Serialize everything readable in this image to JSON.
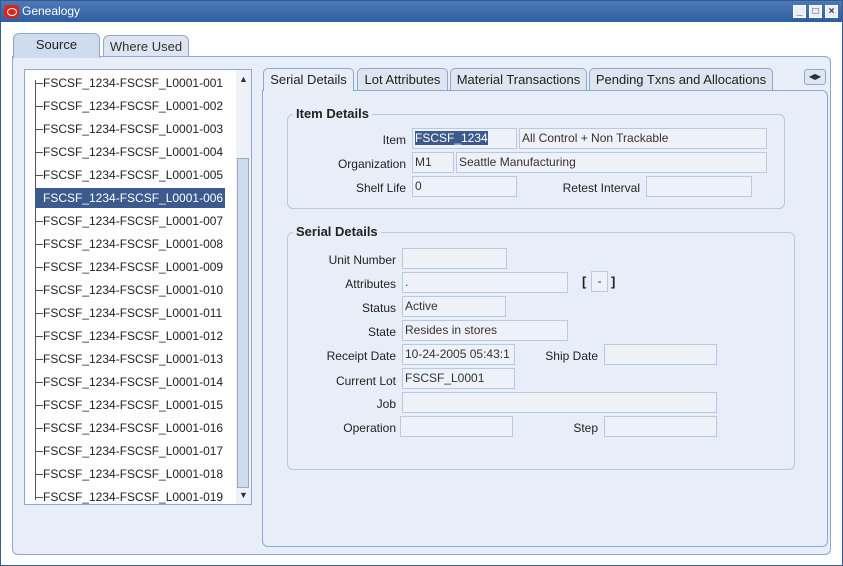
{
  "window": {
    "title": "Genealogy"
  },
  "top_tabs": [
    {
      "label": "Source",
      "active": true
    },
    {
      "label": "Where Used",
      "active": false
    }
  ],
  "tree_items": [
    "FSCSF_1234-FSCSF_L0001-001",
    "FSCSF_1234-FSCSF_L0001-002",
    "FSCSF_1234-FSCSF_L0001-003",
    "FSCSF_1234-FSCSF_L0001-004",
    "FSCSF_1234-FSCSF_L0001-005",
    "FSCSF_1234-FSCSF_L0001-006",
    "FSCSF_1234-FSCSF_L0001-007",
    "FSCSF_1234-FSCSF_L0001-008",
    "FSCSF_1234-FSCSF_L0001-009",
    "FSCSF_1234-FSCSF_L0001-010",
    "FSCSF_1234-FSCSF_L0001-011",
    "FSCSF_1234-FSCSF_L0001-012",
    "FSCSF_1234-FSCSF_L0001-013",
    "FSCSF_1234-FSCSF_L0001-014",
    "FSCSF_1234-FSCSF_L0001-015",
    "FSCSF_1234-FSCSF_L0001-016",
    "FSCSF_1234-FSCSF_L0001-017",
    "FSCSF_1234-FSCSF_L0001-018",
    "FSCSF_1234-FSCSF_L0001-019"
  ],
  "selected_tree_index": 5,
  "sub_tabs": [
    {
      "label": "Serial Details",
      "active": true
    },
    {
      "label": "Lot Attributes",
      "active": false
    },
    {
      "label": "Material Transactions",
      "active": false
    },
    {
      "label": "Pending Txns and Allocations",
      "active": false
    }
  ],
  "item_details": {
    "title": "Item Details",
    "item_label": "Item",
    "item_value": "FSCSF_1234",
    "item_desc": "All Control + Non Trackable",
    "org_label": "Organization",
    "org_code": "M1",
    "org_name": "Seattle Manufacturing",
    "shelf_life_label": "Shelf Life",
    "shelf_life_value": "0",
    "retest_label": "Retest Interval",
    "retest_value": ""
  },
  "serial_details": {
    "title": "Serial Details",
    "unit_number_label": "Unit Number",
    "unit_number_value": "",
    "attributes_label": "Attributes",
    "attributes_value": ".",
    "attributes_dff": "-",
    "status_label": "Status",
    "status_value": "Active",
    "state_label": "State",
    "state_value": "Resides in stores",
    "receipt_date_label": "Receipt Date",
    "receipt_date_value": "10-24-2005 05:43:1",
    "ship_date_label": "Ship Date",
    "ship_date_value": "",
    "current_lot_label": "Current Lot",
    "current_lot_value": "FSCSF_L0001",
    "job_label": "Job",
    "job_value": "",
    "operation_label": "Operation",
    "operation_value": "",
    "step_label": "Step",
    "step_value": ""
  },
  "colors": {
    "titlebar": "#2f5e9f",
    "selection": "#3c5a8e",
    "panel": "#e7eef8"
  }
}
